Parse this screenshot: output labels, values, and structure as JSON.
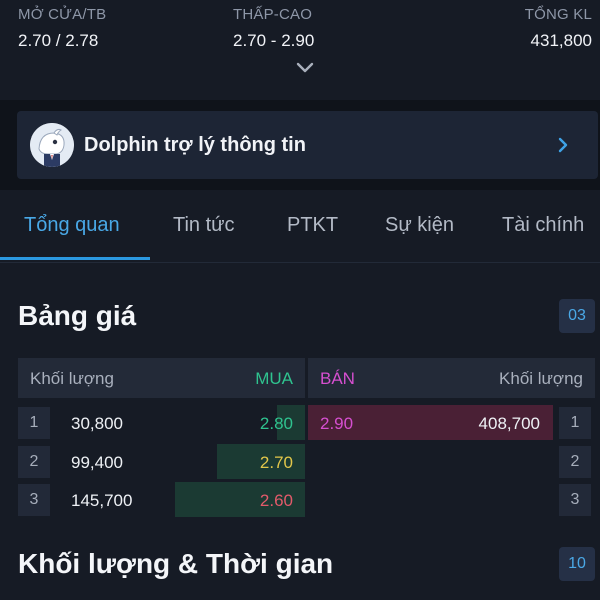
{
  "stats": {
    "open_avg_label": "MỞ CỬA/TB",
    "open_avg_value": "2.70 / 2.78",
    "low_high_label": "THẤP-CAO",
    "low_high_value": "2.70 - 2.90",
    "total_vol_label": "TỔNG KL",
    "total_vol_value": "431,800"
  },
  "banner": {
    "text": "Dolphin trợ lý thông tin"
  },
  "tabs": [
    {
      "label": "Tổng quan",
      "active": true
    },
    {
      "label": "Tin tức"
    },
    {
      "label": "PTKT"
    },
    {
      "label": "Sự kiện"
    },
    {
      "label": "Tài chính"
    }
  ],
  "price_board": {
    "title": "Bảng giá",
    "badge": "03",
    "header": {
      "bid_volume": "Khối lượng",
      "bid": "MUA",
      "ask": "BÁN",
      "ask_volume": "Khối lượng"
    },
    "rows": [
      {
        "index": "1",
        "bid_volume": "30,800",
        "bid_price": "2.80",
        "ask_price": "2.90",
        "ask_volume": "408,700",
        "ask_index": "1"
      },
      {
        "index": "2",
        "bid_volume": "99,400",
        "bid_price": "2.70",
        "ask_price": "",
        "ask_volume": "",
        "ask_index": "2"
      },
      {
        "index": "3",
        "bid_volume": "145,700",
        "bid_price": "2.60",
        "ask_price": "",
        "ask_volume": "",
        "ask_index": "3"
      }
    ]
  },
  "volume_time": {
    "title": "Khối lượng & Thời gian",
    "badge": "10"
  },
  "colors": {
    "accent": "#2b98e0",
    "up": "#2fc38f",
    "ref": "#e2c64a",
    "down": "#e25a6a",
    "ask_pink": "#d64fd0"
  }
}
